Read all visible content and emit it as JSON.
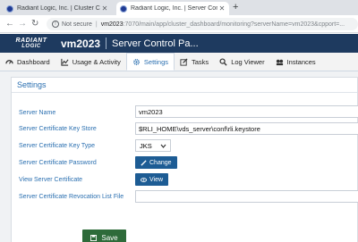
{
  "browser": {
    "tabs": [
      {
        "title": "Radiant Logic, Inc. | Cluster Control",
        "active": false
      },
      {
        "title": "Radiant Logic, Inc. | Server Control Pa",
        "active": true
      }
    ],
    "new_tab_label": "+",
    "address": {
      "security_label": "Not secure",
      "url_host": "vm2023",
      "url_path": ":7070/main/app/cluster_dashboard/monitoring?serverName=vm2023&cpport=..."
    }
  },
  "app": {
    "logo_line1": "RADIANT",
    "logo_line2": "LOGIC",
    "server_name": "vm2023",
    "title": "Server Control Pa..."
  },
  "nav_tabs": [
    {
      "label": "Dashboard",
      "icon": "dashboard-icon",
      "active": false
    },
    {
      "label": "Usage & Activity",
      "icon": "chart-icon",
      "active": false
    },
    {
      "label": "Settings",
      "icon": "gear-icon",
      "active": true
    },
    {
      "label": "Tasks",
      "icon": "pencil-icon",
      "active": false
    },
    {
      "label": "Log Viewer",
      "icon": "search-icon",
      "active": false
    },
    {
      "label": "Instances",
      "icon": "servers-icon",
      "active": false
    }
  ],
  "settings": {
    "title": "Settings",
    "server_name_label": "Server Name",
    "server_name_value": "vm2023",
    "key_store_label": "Server Certificate Key Store",
    "key_store_value": "$RLI_HOME\\vds_server\\conf\\rli.keystore",
    "key_type_label": "Server Certificate Key Type",
    "key_type_value": "JKS",
    "password_label": "Server Certificate Password",
    "change_label": "Change",
    "view_cert_label": "View Server Certificate",
    "view_label": "View",
    "crl_label": "Server Certificate Revocation List File",
    "crl_value": "",
    "save_label": "Save"
  },
  "colors": {
    "header_bg": "#1e3a5f",
    "label_blue": "#2a6fb0",
    "button_blue": "#1d5c94",
    "save_green": "#2e6b3a"
  }
}
